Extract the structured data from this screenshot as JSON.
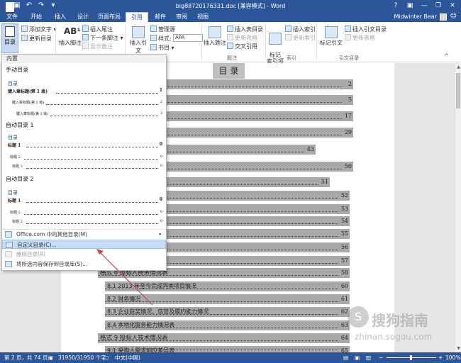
{
  "window": {
    "title": "big88720176331.doc [兼容模式] - Word",
    "controls": [
      "?",
      "▣",
      "—",
      "❐",
      "✕"
    ]
  },
  "quick_access": [
    "save-icon",
    "undo-icon",
    "redo-icon",
    "customize-icon"
  ],
  "tabs": [
    {
      "label": "文件"
    },
    {
      "label": "开始"
    },
    {
      "label": "插入"
    },
    {
      "label": "设计"
    },
    {
      "label": "页面布局"
    },
    {
      "label": "引用",
      "active": true
    },
    {
      "label": "邮件"
    },
    {
      "label": "审阅"
    },
    {
      "label": "视图"
    }
  ],
  "user": {
    "name": "Midwinter Bear"
  },
  "ribbon": {
    "toc": {
      "button": "目录",
      "add_text": "添加文字",
      "update": "更新目录"
    },
    "footnotes": {
      "insert_footnote": "插入脚注",
      "insert_endnote": "插入尾注",
      "next_footnote": "下一条脚注",
      "show_notes": "显示备注"
    },
    "citations": {
      "insert_citation": "插入引文",
      "manage_sources": "管理源",
      "style_label": "样式:",
      "style_value": "APA",
      "bibliography": "书目"
    },
    "captions": {
      "insert_caption": "插入题注",
      "insert_table_of_figures": "插入表目录",
      "update_table": "更新表格",
      "cross_reference": "交叉引用",
      "group": "题注"
    },
    "index": {
      "mark_entry": "标记\n索引项",
      "insert_index": "插入索引",
      "update_index": "更新索引",
      "group": "索引"
    },
    "toa": {
      "mark_citation": "标记引文",
      "insert_toa": "插入引文目录",
      "update_table": "更新表格",
      "group": "引文目录"
    },
    "group_toc_tail": "目",
    "group_citations_tail": "书目"
  },
  "dropdown": {
    "header": "内置",
    "manual": {
      "section": "手动目录",
      "title": "目录",
      "lines": [
        {
          "text": "键入章标题(第 1 级)",
          "page": "1"
        },
        {
          "text": "键入章标题(第 2 级)",
          "page": "2"
        },
        {
          "text": "键入章标题(第 3 级)",
          "page": "3"
        }
      ]
    },
    "auto1": {
      "section": "自动目录 1",
      "title": "目录",
      "lines": [
        {
          "text": "标题 1",
          "page": "0"
        },
        {
          "text": "标题 2",
          "page": "0"
        },
        {
          "text": "标题 3",
          "page": "0"
        }
      ]
    },
    "auto2": {
      "section": "自动目录 2",
      "title": "目录",
      "lines": [
        {
          "text": "标题 1",
          "page": "0"
        },
        {
          "text": "标题 2",
          "page": "0"
        },
        {
          "text": "标题 3",
          "page": "0"
        }
      ]
    },
    "items": [
      {
        "label": "Office.com 中的其他目录(M)",
        "arrow": "▸"
      },
      {
        "label": "自定义目录(C)..."
      },
      {
        "label": "删除目录(R)"
      },
      {
        "label": "将所选内容保存到目录库(S)..."
      }
    ]
  },
  "document": {
    "title": "目  录",
    "entries": [
      {
        "text": "",
        "page": "2"
      },
      {
        "text": "",
        "page": "5"
      },
      {
        "text": "",
        "page": "17"
      },
      {
        "text": "",
        "page": "29"
      },
      {
        "text": "",
        "page": "43"
      },
      {
        "text": "",
        "page": "50"
      },
      {
        "text": "",
        "page": "51"
      },
      {
        "text": "",
        "page": "52"
      },
      {
        "text": "",
        "page": "53"
      },
      {
        "text": "书",
        "page": "54"
      },
      {
        "text": "委托书",
        "page": "55"
      },
      {
        "text": "表",
        "page": "56"
      },
      {
        "text": "",
        "page": "57"
      },
      {
        "text": "格式 8 投标人商务情况表",
        "page": "58"
      },
      {
        "text": "8.1  2013 年至今完成同类项目情况",
        "page": "60"
      },
      {
        "text": "8.2  财务情况",
        "page": "61"
      },
      {
        "text": "8.3  企业获奖情况、信誉及履约能力情况",
        "page": "62"
      },
      {
        "text": "8.4  本地化服务能力情况表",
        "page": "63"
      },
      {
        "text": "格式 9 投标人技术情况表",
        "page": "64"
      },
      {
        "text": "9.1  采购人需求响应差异表",
        "page": "65"
      }
    ]
  },
  "watermark": {
    "cn": "搜狗指南",
    "url": "zhinan.sogou.com"
  },
  "status": {
    "page": "第 2 页，共 74 页",
    "words": "31950/31950 个字",
    "lang": "中文(中国)",
    "zoom": "100%"
  }
}
